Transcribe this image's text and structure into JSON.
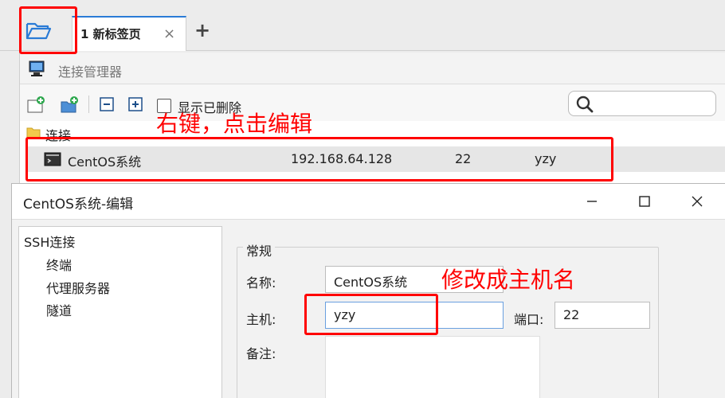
{
  "tabbar": {
    "tab_label": "1 新标签页",
    "tab_close": "×",
    "add_tab": "+"
  },
  "connection_manager": {
    "title": "连接管理器",
    "toolbar": {
      "show_deleted_label": "显示已删除",
      "search_placeholder": ""
    },
    "tree": {
      "root_label": "连接",
      "connections": [
        {
          "name": "CentOS系统",
          "host": "192.168.64.128",
          "port": "22",
          "user": "yzy"
        }
      ]
    }
  },
  "annotations": {
    "right_click_edit": "右键，点击编辑",
    "change_to_hostname": "修改成主机名"
  },
  "edit_dialog": {
    "title": "CentOS系统-编辑",
    "nav": [
      "SSH连接",
      "终端",
      "代理服务器",
      "隧道"
    ],
    "group_title": "常规",
    "fields": {
      "name_label": "名称:",
      "name_value": "CentOS系统",
      "host_label": "主机:",
      "host_value": "yzy",
      "port_label": "端口:",
      "port_value": "22",
      "notes_label": "备注:"
    }
  },
  "colors": {
    "tab_accent": "#2a7bd6",
    "annotation": "#ff0000",
    "selected_row": "#e6e6e6"
  }
}
